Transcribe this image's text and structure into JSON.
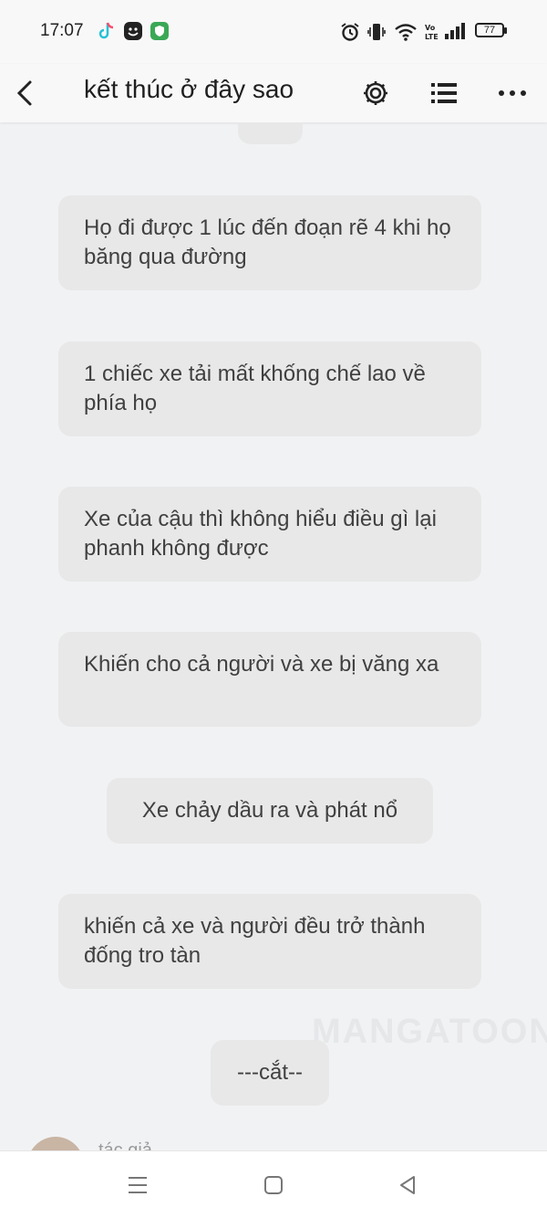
{
  "status_bar": {
    "time": "17:07",
    "battery": "77",
    "icons": [
      "tiktok-icon",
      "face-app-icon",
      "shield-app-icon",
      "alarm-icon",
      "vibrate-icon",
      "wifi-icon",
      "volte-icon",
      "signal-icon",
      "battery-icon"
    ]
  },
  "app_bar": {
    "title": "kết thúc ở đây sao",
    "icons": [
      "back-icon",
      "gear-icon",
      "list-icon",
      "more-icon"
    ]
  },
  "messages": [
    "Họ đi được 1 lúc đến đoạn rẽ 4 khi họ băng qua đường",
    "1 chiếc xe tải mất khống chế lao về phía họ",
    "Xe của cậu thì không hiểu điều gì lại phanh không được",
    "Khiến cho cả người và xe bị văng xa",
    "Xe chảy dầu ra và phát nổ",
    "khiến cả xe và người đều trở thành đống tro tàn",
    "---cắt--"
  ],
  "watermark": "MANGATOON",
  "author": {
    "label": "tác giả"
  },
  "nav_bar": {
    "icons": [
      "menu-icon",
      "home-icon",
      "back-triangle-icon"
    ]
  },
  "colors": {
    "background": "#f1f2f4",
    "bubble": "#e8e8e8",
    "text": "#404040"
  }
}
